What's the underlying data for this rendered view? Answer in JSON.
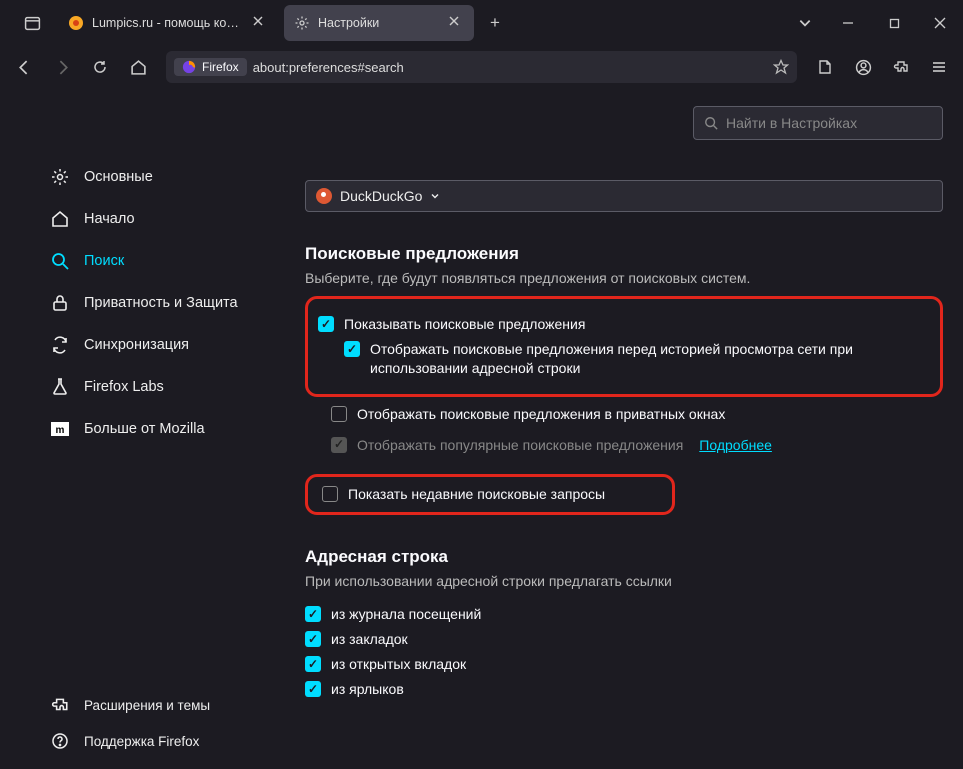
{
  "tabs": {
    "t1": {
      "label": "Lumpics.ru - помощь компь"
    },
    "t2": {
      "label": "Настройки"
    }
  },
  "urlbar": {
    "badge": "Firefox",
    "address": "about:preferences#search"
  },
  "search": {
    "placeholder": "Найти в Настройках"
  },
  "sidebar": {
    "general": "Основные",
    "home": "Начало",
    "search": "Поиск",
    "privacy": "Приватность и Защита",
    "sync": "Синхронизация",
    "labs": "Firefox Labs",
    "more": "Больше от Mozilla",
    "ext": "Расширения и темы",
    "support": "Поддержка Firefox"
  },
  "engine": {
    "name": "DuckDuckGo"
  },
  "section1": {
    "title": "Поисковые предложения",
    "subtitle": "Выберите, где будут появляться предложения от поисковых систем.",
    "opt_show": "Показывать поисковые предложения",
    "opt_before_history": "Отображать поисковые предложения перед историей просмотра сети при использовании адресной строки",
    "opt_private": "Отображать поисковые предложения в приватных окнах",
    "opt_popular": "Отображать популярные поисковые предложения",
    "learn_more": "Подробнее",
    "opt_recent": "Показать недавние поисковые запросы"
  },
  "section2": {
    "title": "Адресная строка",
    "subtitle": "При использовании адресной строки предлагать ссылки",
    "opt_history": "из журнала посещений",
    "opt_bookmarks": "из закладок",
    "opt_tabs": "из открытых вкладок",
    "opt_shortcuts": "из ярлыков"
  }
}
